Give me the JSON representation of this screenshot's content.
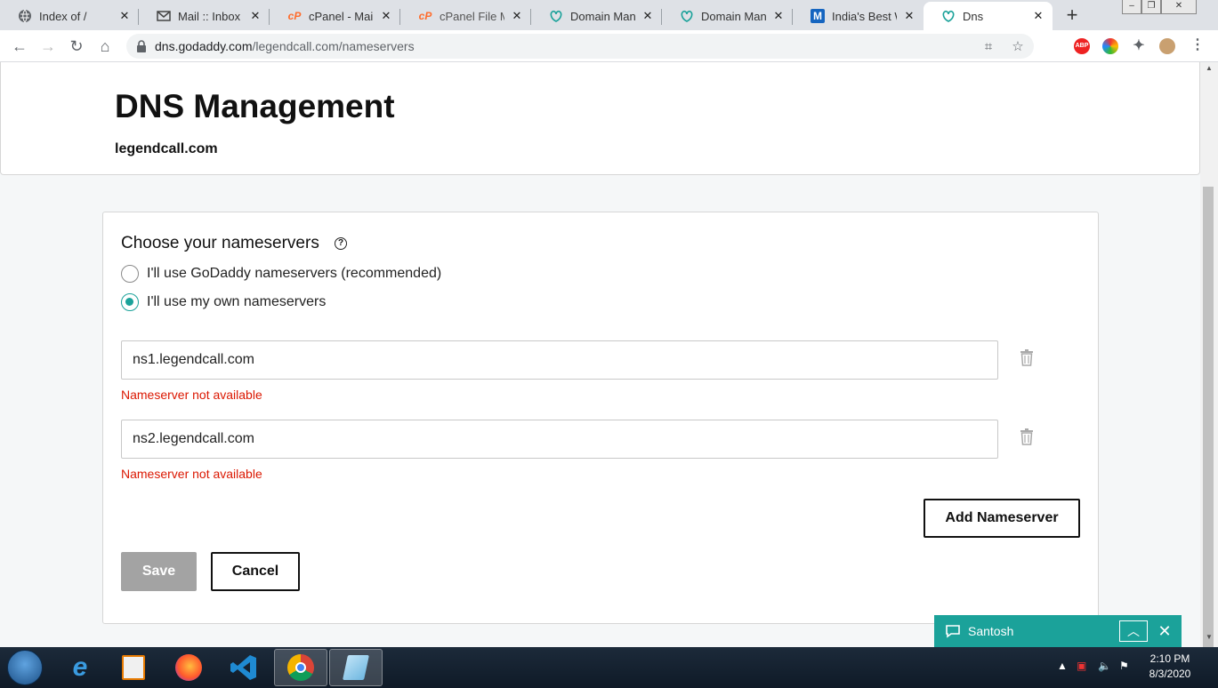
{
  "browser": {
    "tabs": [
      {
        "title": "Index of /",
        "icon": "globe-icon"
      },
      {
        "title": "Mail :: Inbox",
        "icon": "mail-icon"
      },
      {
        "title": "cPanel - Main",
        "icon": "cpanel-icon"
      },
      {
        "title": "cPanel File Man",
        "icon": "cpanel-icon"
      },
      {
        "title": "Domain Manag",
        "icon": "godaddy-icon"
      },
      {
        "title": "Domain Manag",
        "icon": "godaddy-icon"
      },
      {
        "title": "India's Best We",
        "icon": "m-logo-icon"
      },
      {
        "title": "Dns",
        "icon": "godaddy-icon"
      }
    ],
    "active_tab": 7,
    "url_host": "dns.godaddy.com",
    "url_path": "/legendcall.com/nameservers",
    "accent": "#1ba29a"
  },
  "page": {
    "title": "DNS Management",
    "domain": "legendcall.com",
    "section_title": "Choose your nameservers",
    "options": [
      {
        "label": "I'll use GoDaddy nameservers (recommended)",
        "selected": false
      },
      {
        "label": "I'll use my own nameservers",
        "selected": true
      }
    ],
    "nameservers": [
      {
        "value": "ns1.legendcall.com",
        "error": "Nameserver not available"
      },
      {
        "value": "ns2.legendcall.com",
        "error": "Nameserver not available"
      }
    ],
    "add_button": "Add Nameserver",
    "save_button": "Save",
    "cancel_button": "Cancel",
    "error_color": "#db1802"
  },
  "chat": {
    "name": "Santosh"
  },
  "taskbar": {
    "time": "2:10 PM",
    "date": "8/3/2020"
  }
}
